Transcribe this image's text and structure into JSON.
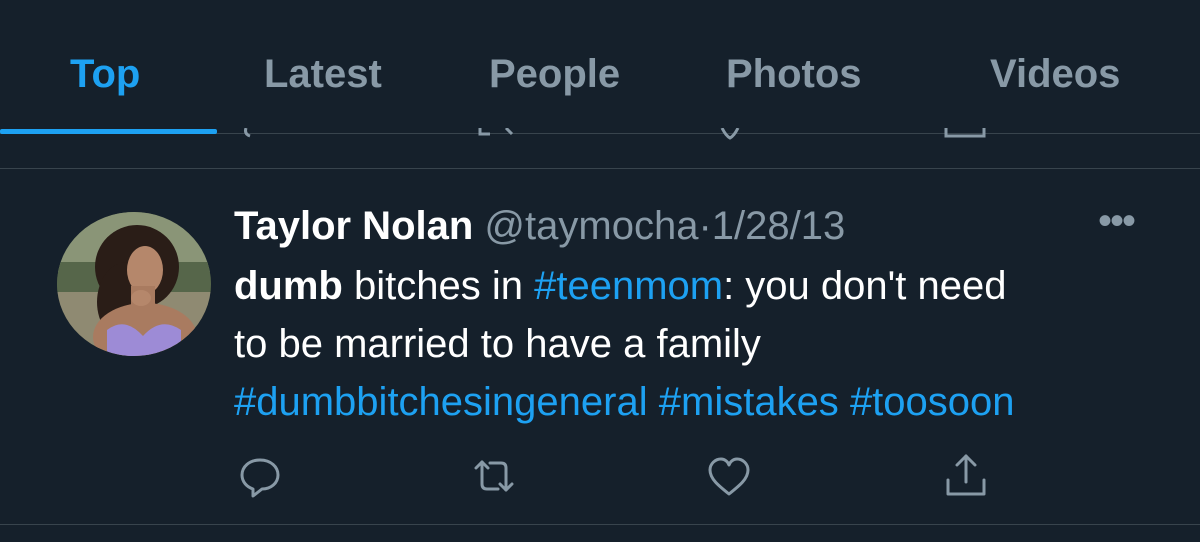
{
  "tabs": [
    {
      "label": "Top",
      "active": true
    },
    {
      "label": "Latest",
      "active": false
    },
    {
      "label": "People",
      "active": false
    },
    {
      "label": "Photos",
      "active": false
    },
    {
      "label": "Videos",
      "active": false
    }
  ],
  "colors": {
    "background": "#15202b",
    "accent": "#1da1f2",
    "secondary_text": "#8899a6",
    "divider": "#38444d"
  },
  "tweet": {
    "display_name": "Taylor Nolan",
    "handle": "@taymocha",
    "separator": "·",
    "date": "1/28/13",
    "more": "•••",
    "text": {
      "line1_bold": "dumb",
      "line1_a": " bitches in ",
      "line1_tag": "#teenmom",
      "line1_b": ": you don't need",
      "line2": "to be married to have a family",
      "tag1": "#dumbbitchesingeneral",
      "tag2": "#mistakes",
      "tag3": "#toosoon"
    },
    "actions": [
      "reply-icon",
      "retweet-icon",
      "like-icon",
      "share-icon"
    ]
  }
}
